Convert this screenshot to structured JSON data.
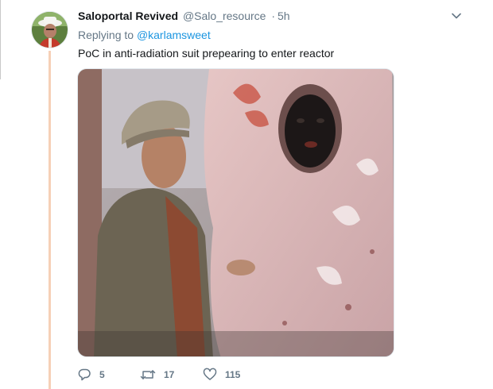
{
  "tweet": {
    "display_name": "Saloportal Revived",
    "handle": "@Salo_resource",
    "separator": "·",
    "time": "5h",
    "replying_prefix": "Replying to",
    "replying_mention": "@karlamsweet",
    "text": "PoC in anti-radiation suit prepearing to enter reactor"
  },
  "actions": {
    "reply_count": "5",
    "retweet_count": "17",
    "like_count": "115"
  },
  "icons": {
    "menu": "chevron-down-icon",
    "reply": "reply-icon",
    "retweet": "retweet-icon",
    "like": "heart-icon"
  },
  "colors": {
    "link": "#1b95e0",
    "muted": "#657786",
    "thread_line": "#f6d0b7",
    "text": "#14171a"
  }
}
